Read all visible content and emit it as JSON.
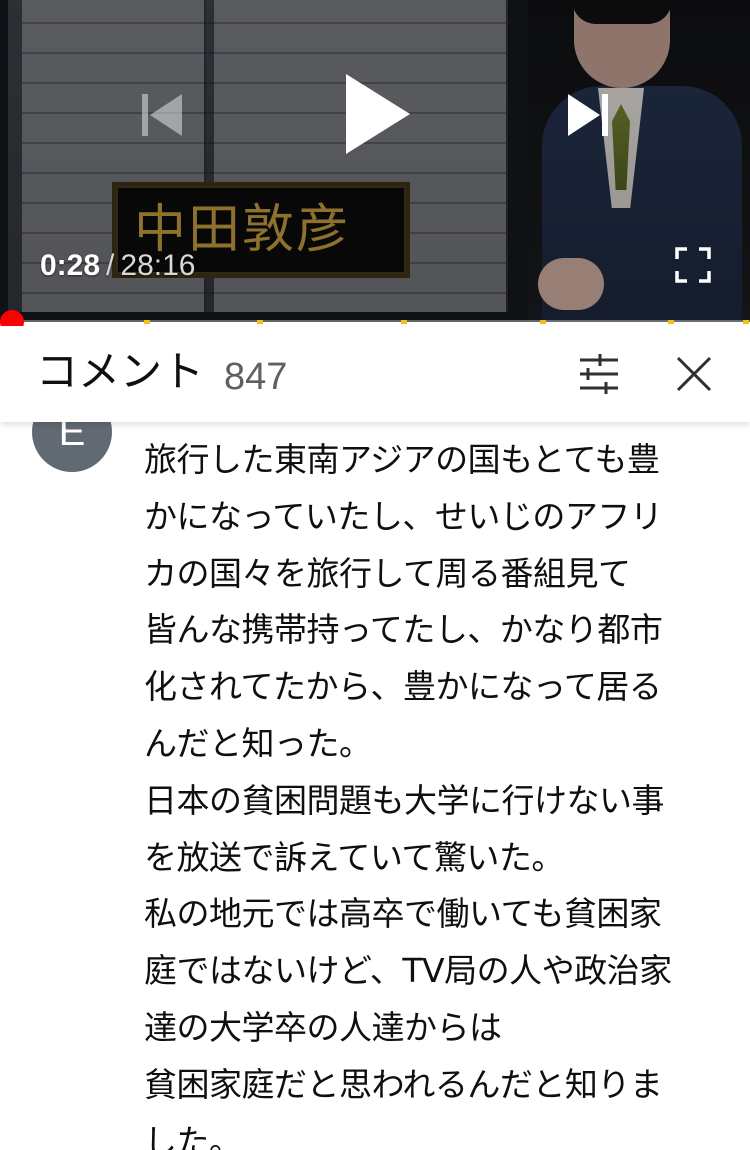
{
  "player": {
    "caption_text": "中田敦彦",
    "time_current": "0:28",
    "time_separator": "/",
    "time_duration": "28:16",
    "progress_fraction": 0.0165,
    "chapter_marker_fractions": [
      0.192,
      0.343,
      0.535,
      0.72,
      0.89,
      0.99
    ],
    "icons": {
      "prev": "skip-previous-icon",
      "play": "play-icon",
      "next": "skip-next-icon",
      "fullscreen": "fullscreen-icon"
    },
    "colors": {
      "progress": "#ff0000",
      "chapter_marker": "#f2c01b",
      "caption_text": "#b8913b"
    }
  },
  "comments_panel": {
    "title": "コメント",
    "count": "847",
    "icons": {
      "sort": "tune-icon",
      "close": "close-icon"
    }
  },
  "comment": {
    "avatar_letter": "E",
    "avatar_color": "#616972",
    "lines": [
      "旅行した東南アジアの国もとても豊",
      "かになっていたし、せいじのアフリ",
      "カの国々を旅行して周る番組見て",
      "皆んな携帯持ってたし、かなり都市",
      "化されてたから、豊かになって居る",
      "んだと知った。",
      "日本の貧困問題も大学に行けない事",
      "を放送で訴えていて驚いた。",
      "私の地元では高卒で働いても貧困家",
      "庭ではないけど、TV局の人や政治家",
      "達の大学卒の人達からは",
      "貧困家庭だと思われるんだと知りま",
      "した。"
    ]
  }
}
